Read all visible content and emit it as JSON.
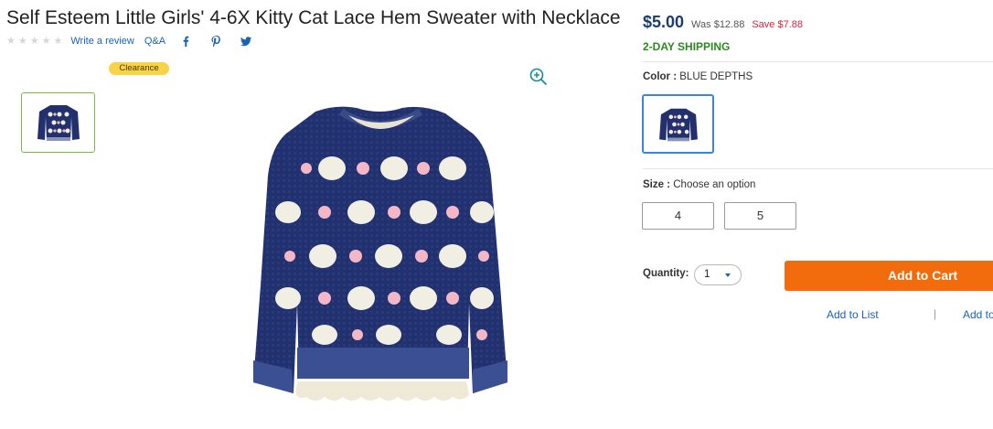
{
  "product": {
    "title": "Self Esteem Little Girls' 4-6X Kitty Cat Lace Hem Sweater with Necklace",
    "rating_stars": 0,
    "write_review": "Write a review",
    "qa": "Q&A",
    "badge": "Clearance"
  },
  "social": [
    "facebook-icon",
    "pinterest-icon",
    "twitter-icon"
  ],
  "pricing": {
    "price": "$5.00",
    "was": "Was $12.88",
    "save": "Save $7.88",
    "shipping": "2-DAY SHIPPING"
  },
  "color": {
    "label": "Color :",
    "value": "BLUE DEPTHS"
  },
  "size": {
    "label": "Size :",
    "prompt": "Choose an option",
    "options": [
      "4",
      "5"
    ]
  },
  "quantity": {
    "label": "Quantity:",
    "value": "1"
  },
  "actions": {
    "add_to_cart": "Add to Cart",
    "add_to_list": "Add to List",
    "add_to_registry": "Add to"
  },
  "colors": {
    "navy": "#1a3e6e",
    "link": "#1b62b3",
    "shipping": "#2b8a1e",
    "save": "#d0243a",
    "cart": "#f26c0d",
    "badge": "#f8d34a",
    "sweater": "#22306e"
  }
}
